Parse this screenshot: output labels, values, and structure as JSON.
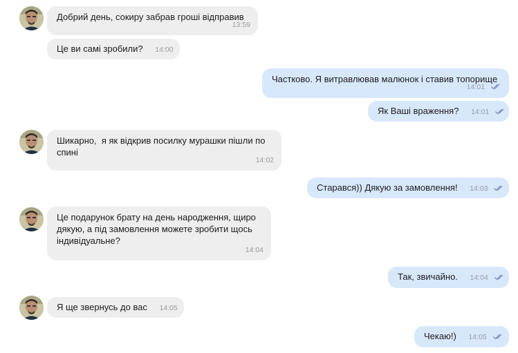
{
  "messages": [
    {
      "text": "Добрий день, сокиру забрав гроші відправив",
      "time": "13:59"
    },
    {
      "text": "Це ви самі зробили?",
      "time": "14:00"
    },
    {
      "text": "Частково. Я витравлював малюнок і ставив топорище",
      "time": "14:01"
    },
    {
      "text": "Як Ваші враження?",
      "time": "14:01"
    },
    {
      "text": "Шикарно,  я як відкрив посилку мурашки пішли по спині",
      "time": "14:02"
    },
    {
      "text": "Старався)) Дякую за замовлення!",
      "time": "14:03"
    },
    {
      "text": "Це подарунок брату на день народження, щиро дякую, а під замовлення можете зробити щось індивідуальне?",
      "time": "14:04"
    },
    {
      "text": "Так, звичайно.",
      "time": "14:04"
    },
    {
      "text": "Я ще звернусь до вас",
      "time": "14:05"
    },
    {
      "text": "Чекаю!)",
      "time": "14:05"
    }
  ],
  "colors": {
    "incoming_bubble": "#eeeeee",
    "outgoing_bubble": "#d8e8fb",
    "read_check": "#7b8fc6"
  },
  "icons": {
    "avatar": "contact-avatar",
    "read": "double-check-icon"
  }
}
